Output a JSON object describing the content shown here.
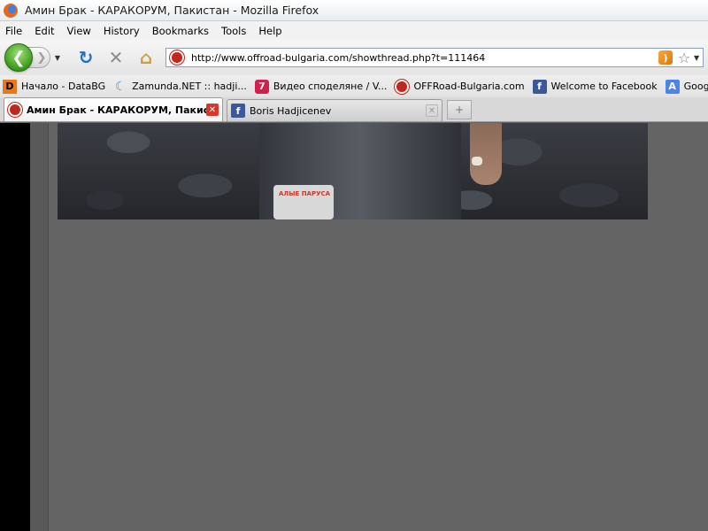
{
  "window": {
    "title": "Амин Брак - КАРАКОРУМ, Пакистан - Mozilla Firefox"
  },
  "menu": {
    "items": [
      "File",
      "Edit",
      "View",
      "History",
      "Bookmarks",
      "Tools",
      "Help"
    ]
  },
  "navigation": {
    "back_arrow": "❮",
    "forward_arrow": "❯",
    "dropdown_arrow": "▼",
    "reload_glyph": "↻",
    "stop_glyph": "✕",
    "home_glyph": "⌂",
    "star_glyph": "☆",
    "rss_glyph": ")",
    "url": "http://www.offroad-bulgaria.com/showthread.php?t=111464"
  },
  "bookmarks": {
    "items": [
      {
        "label": "Начало - DataBG",
        "icon": "D"
      },
      {
        "label": "Zamunda.NET :: hadji...",
        "icon": "☾"
      },
      {
        "label": "Видео споделяне / V...",
        "icon": "7"
      },
      {
        "label": "OFFRoad-Bulgaria.com",
        "icon": ""
      },
      {
        "label": "Welcome to Facebook",
        "icon": "f"
      },
      {
        "label": "Google Преводач",
        "icon": "A"
      }
    ],
    "more_glyph": "»"
  },
  "tabs": {
    "items": [
      {
        "label": "Амин Брак - КАРАКОРУМ, Пакистан - Mozilla Firefox",
        "display": "Амин Брак - КАРАКОРУМ, Пакис...",
        "close": "✕"
      },
      {
        "label": "Boris Hadjicenev",
        "display": "Boris Hadjicenev",
        "close": "✕"
      }
    ],
    "new_tab_glyph": "+"
  },
  "content": {
    "photo_patch_text": "АЛЫЕ ПАРУСА"
  },
  "colors": {
    "background": "#636363",
    "back_button": "#3c9a1c",
    "site_favicon": "#c0281c",
    "facebook": "#3b5998"
  }
}
